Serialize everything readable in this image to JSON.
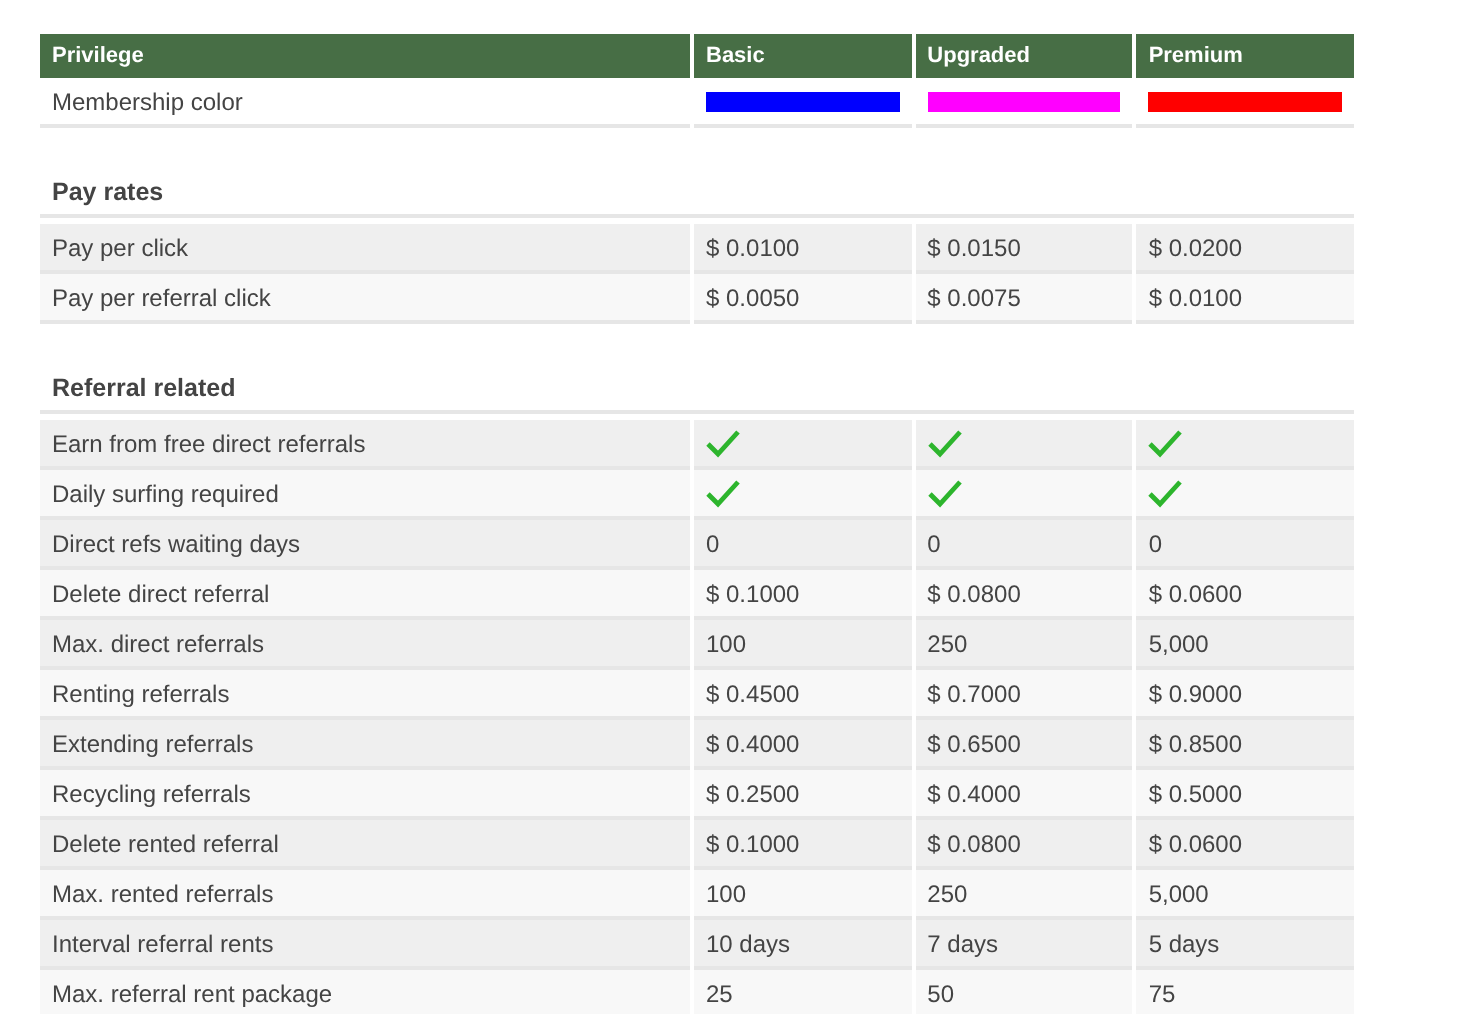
{
  "table": {
    "columns": [
      "Privilege",
      "Basic",
      "Upgraded",
      "Premium"
    ],
    "sections": [
      {
        "rows": [
          {
            "label": "Membership color",
            "cells": [
              {
                "kind": "color",
                "color": "#0000ff"
              },
              {
                "kind": "color",
                "color": "#ff00ff"
              },
              {
                "kind": "color",
                "color": "#ff0000"
              }
            ]
          }
        ]
      },
      {
        "title": "Pay rates",
        "rows": [
          {
            "label": "Pay per click",
            "cells": [
              {
                "kind": "text",
                "text": "$ 0.0100"
              },
              {
                "kind": "text",
                "text": "$ 0.0150"
              },
              {
                "kind": "text",
                "text": "$ 0.0200"
              }
            ]
          },
          {
            "label": "Pay per referral click",
            "cells": [
              {
                "kind": "text",
                "text": "$ 0.0050"
              },
              {
                "kind": "text",
                "text": "$ 0.0075"
              },
              {
                "kind": "text",
                "text": "$ 0.0100"
              }
            ]
          }
        ]
      },
      {
        "title": "Referral related",
        "rows": [
          {
            "label": "Earn from free direct referrals",
            "cells": [
              {
                "kind": "check",
                "checked": true
              },
              {
                "kind": "check",
                "checked": true
              },
              {
                "kind": "check",
                "checked": true
              }
            ]
          },
          {
            "label": "Daily surfing required",
            "cells": [
              {
                "kind": "check",
                "checked": true
              },
              {
                "kind": "check",
                "checked": true
              },
              {
                "kind": "check",
                "checked": true
              }
            ]
          },
          {
            "label": "Direct refs waiting days",
            "cells": [
              {
                "kind": "text",
                "text": "0"
              },
              {
                "kind": "text",
                "text": "0"
              },
              {
                "kind": "text",
                "text": "0"
              }
            ]
          },
          {
            "label": "Delete direct referral",
            "cells": [
              {
                "kind": "text",
                "text": "$ 0.1000"
              },
              {
                "kind": "text",
                "text": "$ 0.0800"
              },
              {
                "kind": "text",
                "text": "$ 0.0600"
              }
            ]
          },
          {
            "label": "Max. direct referrals",
            "cells": [
              {
                "kind": "text",
                "text": "100"
              },
              {
                "kind": "text",
                "text": "250"
              },
              {
                "kind": "text",
                "text": "5,000"
              }
            ]
          },
          {
            "label": "Renting referrals",
            "cells": [
              {
                "kind": "text",
                "text": "$ 0.4500"
              },
              {
                "kind": "text",
                "text": "$ 0.7000"
              },
              {
                "kind": "text",
                "text": "$ 0.9000"
              }
            ]
          },
          {
            "label": "Extending referrals",
            "cells": [
              {
                "kind": "text",
                "text": "$ 0.4000"
              },
              {
                "kind": "text",
                "text": "$ 0.6500"
              },
              {
                "kind": "text",
                "text": "$ 0.8500"
              }
            ]
          },
          {
            "label": "Recycling referrals",
            "cells": [
              {
                "kind": "text",
                "text": "$ 0.2500"
              },
              {
                "kind": "text",
                "text": "$ 0.4000"
              },
              {
                "kind": "text",
                "text": "$ 0.5000"
              }
            ]
          },
          {
            "label": "Delete rented referral",
            "cells": [
              {
                "kind": "text",
                "text": "$ 0.1000"
              },
              {
                "kind": "text",
                "text": "$ 0.0800"
              },
              {
                "kind": "text",
                "text": "$ 0.0600"
              }
            ]
          },
          {
            "label": "Max. rented referrals",
            "cells": [
              {
                "kind": "text",
                "text": "100"
              },
              {
                "kind": "text",
                "text": "250"
              },
              {
                "kind": "text",
                "text": "5,000"
              }
            ]
          },
          {
            "label": "Interval referral rents",
            "cells": [
              {
                "kind": "text",
                "text": "10 days"
              },
              {
                "kind": "text",
                "text": "7 days"
              },
              {
                "kind": "text",
                "text": "5 days"
              }
            ]
          },
          {
            "label": "Max. referral rent package",
            "cells": [
              {
                "kind": "text",
                "text": "25"
              },
              {
                "kind": "text",
                "text": "50"
              },
              {
                "kind": "text",
                "text": "75"
              }
            ]
          }
        ]
      }
    ]
  }
}
